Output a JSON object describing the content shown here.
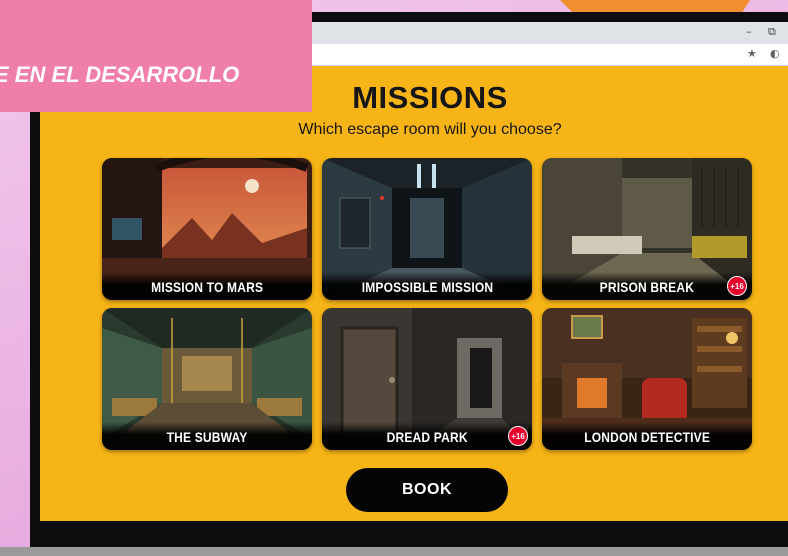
{
  "overlay": {
    "banner_text": "E EN EL DESARROLLO"
  },
  "browser": {
    "minimize_glyph": "–",
    "restore_glyph": "⧉",
    "star_icon": "star-icon",
    "extension_icon": "extension-icon"
  },
  "site": {
    "title": "MISSIONS",
    "subtitle": "Which escape room will you choose?",
    "rooms": [
      {
        "label": "MISSION TO MARS",
        "badge": ""
      },
      {
        "label": "IMPOSSIBLE MISSION",
        "badge": ""
      },
      {
        "label": "PRISON BREAK",
        "badge": "+16"
      },
      {
        "label": "THE SUBWAY",
        "badge": ""
      },
      {
        "label": "DREAD PARK",
        "badge": "+16"
      },
      {
        "label": "LONDON DETECTIVE",
        "badge": ""
      }
    ],
    "book_label": "BOOK"
  },
  "colors": {
    "site_background": "#f7b416",
    "banner_pink": "#ef7faa",
    "stripe_orange": "#f08a1c",
    "button_black": "#050505",
    "badge_red": "#e4002b"
  }
}
